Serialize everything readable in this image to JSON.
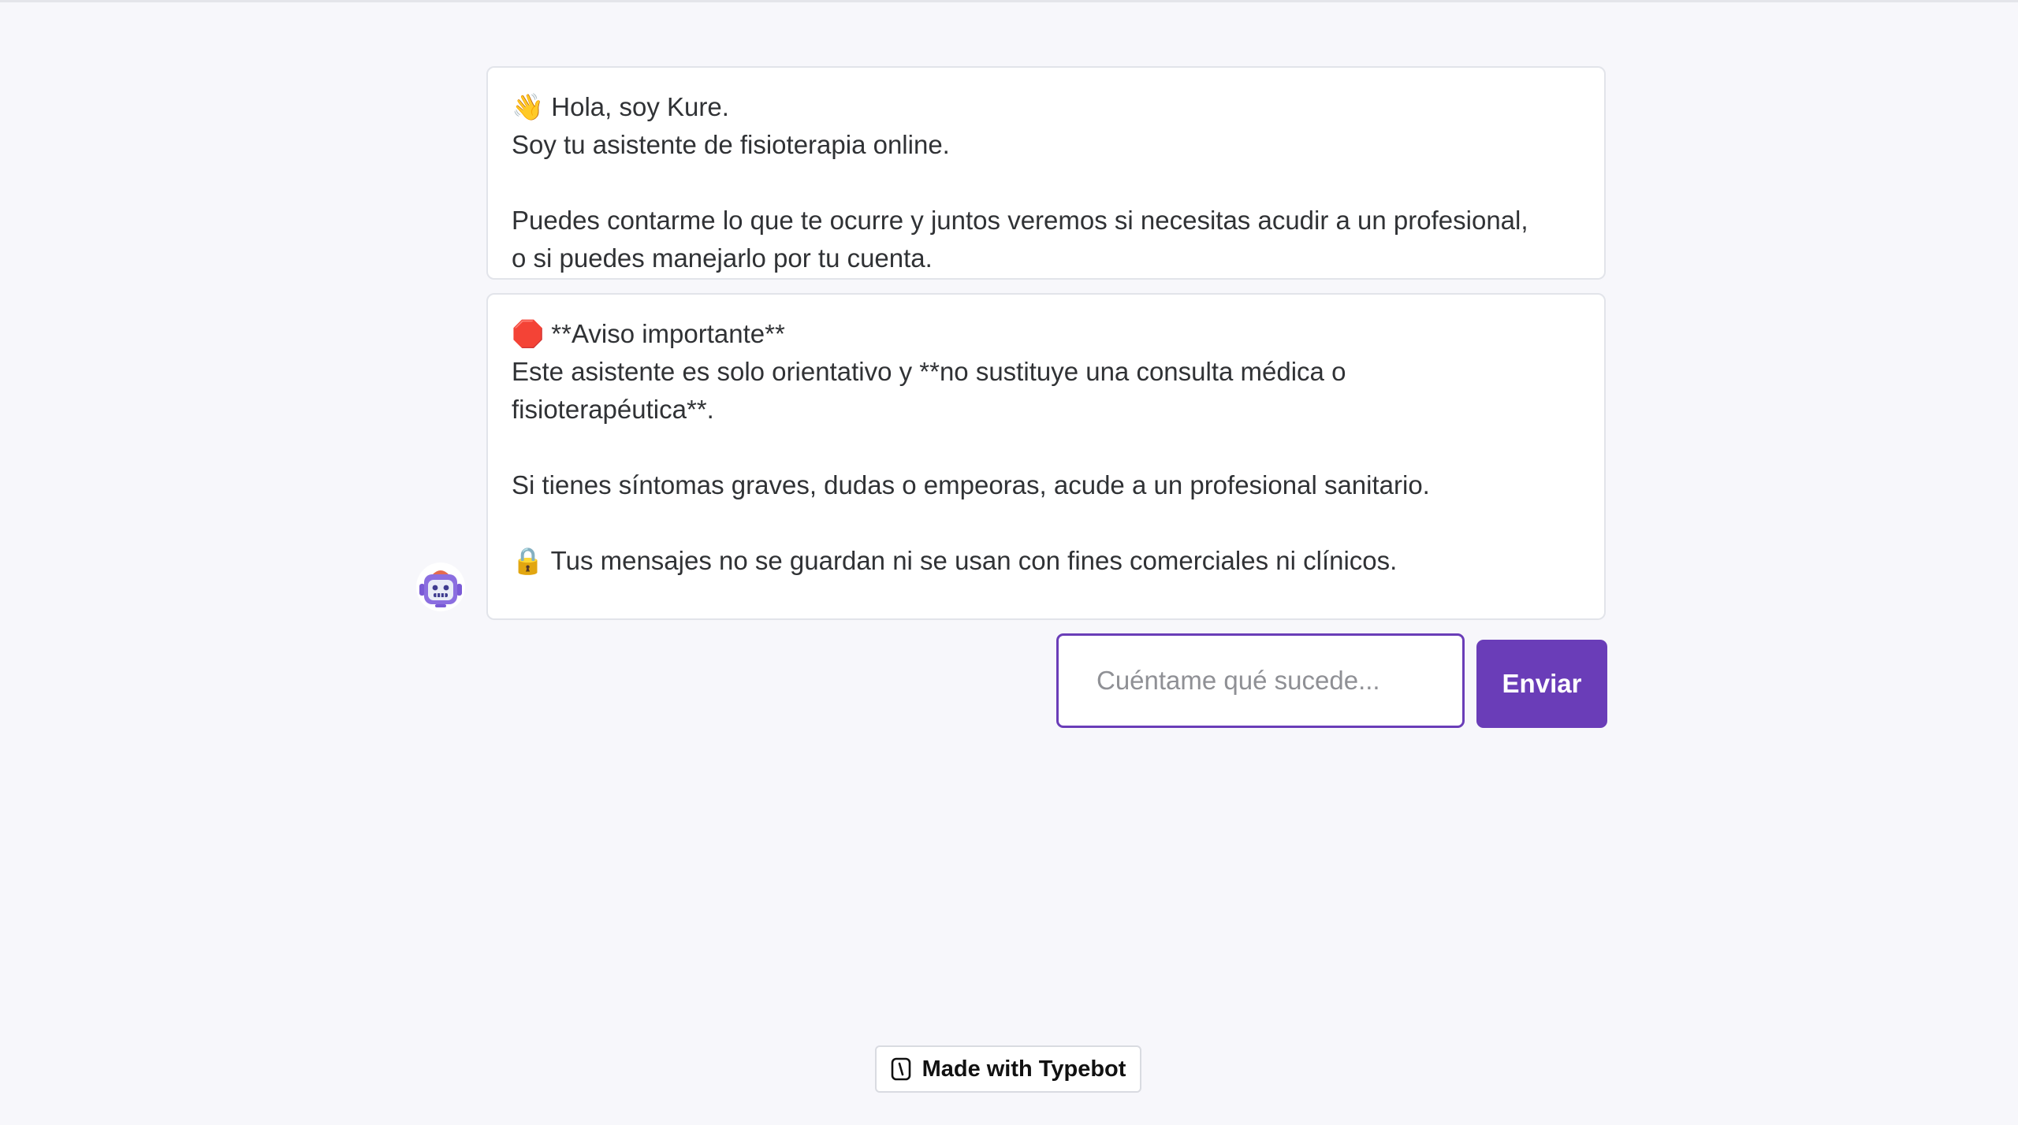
{
  "chat": {
    "messages": [
      {
        "text": "👋 Hola, soy Kure.\nSoy tu asistente de fisioterapia online.\n\nPuedes contarme lo que te ocurre y juntos veremos si necesitas acudir a un profesional,\no si puedes manejarlo por tu cuenta."
      },
      {
        "text": "🛑 **Aviso importante**\nEste asistente es solo orientativo y **no sustituye una consulta médica o\nfisioterapéutica**.\n\nSi tienes síntomas graves, dudas o empeoras, acude a un profesional sanitario.\n\n🔒 Tus mensajes no se guardan ni se usan con fines comerciales ni clínicos."
      }
    ],
    "avatar_icon": "robot-icon"
  },
  "input": {
    "placeholder": "Cuéntame qué sucede...",
    "value": ""
  },
  "send_button": {
    "label": "Enviar"
  },
  "badge": {
    "label": "Made with Typebot",
    "icon": "typebot-logo-icon"
  },
  "colors": {
    "accent": "#6a3db8",
    "background": "#f7f7fb",
    "bubble_bg": "#ffffff",
    "text": "#303235"
  }
}
